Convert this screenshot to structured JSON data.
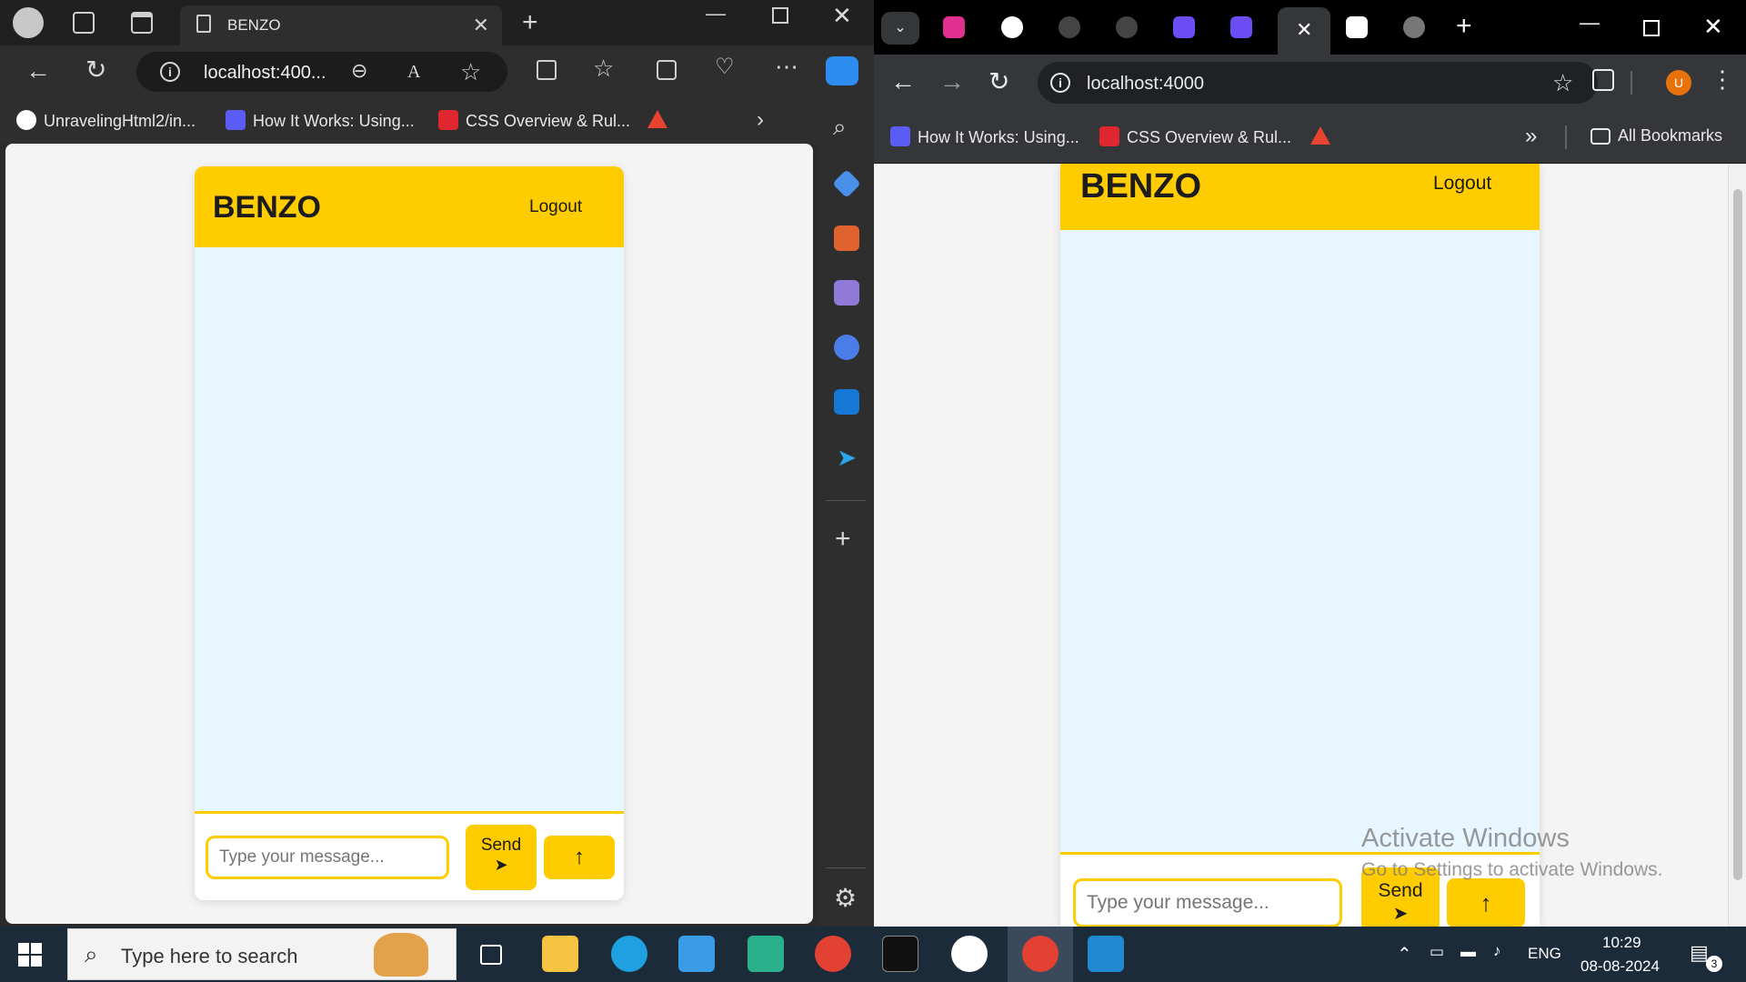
{
  "edge": {
    "tab_title": "BENZO",
    "url": "localhost:400...",
    "bookmarks": [
      {
        "label": "UnravelingHtml2/in...",
        "color": "#ffffff"
      },
      {
        "label": "How It Works: Using...",
        "color": "#5b5bf5"
      },
      {
        "label": "CSS Overview & Rul...",
        "color": "#e0262f"
      },
      {
        "label": "",
        "color": "#e8432e"
      }
    ]
  },
  "chrome": {
    "url": "localhost:4000",
    "bookmarks": [
      {
        "label": "How It Works: Using...",
        "color": "#5b5bf5"
      },
      {
        "label": "CSS Overview & Rul...",
        "color": "#e0262f"
      },
      {
        "label": "",
        "color": "#e8432e"
      }
    ],
    "all_bookmarks": "All Bookmarks",
    "profile_initial": "U",
    "tab_icon_colors": [
      "#e0308f",
      "#ffffff",
      "#444444",
      "#444444",
      "#6b4cf5",
      "#6b4cf5",
      "#ffffff",
      "#ffffff",
      "#777777"
    ]
  },
  "app": {
    "brand": "BENZO",
    "logout": "Logout",
    "input_placeholder": "Type your message...",
    "send_label": "Send",
    "send_icon": "paper-plane-icon",
    "up_icon": "arrow-up-icon",
    "accent_color": "#ffcc00",
    "chat_bg": "#e8f7ff"
  },
  "watermark": {
    "line1": "Activate Windows",
    "line2": "Go to Settings to activate Windows."
  },
  "taskbar": {
    "search_placeholder": "Type here to search",
    "language": "ENG",
    "time": "10:29",
    "date": "08-08-2024",
    "notification_count": "3"
  }
}
